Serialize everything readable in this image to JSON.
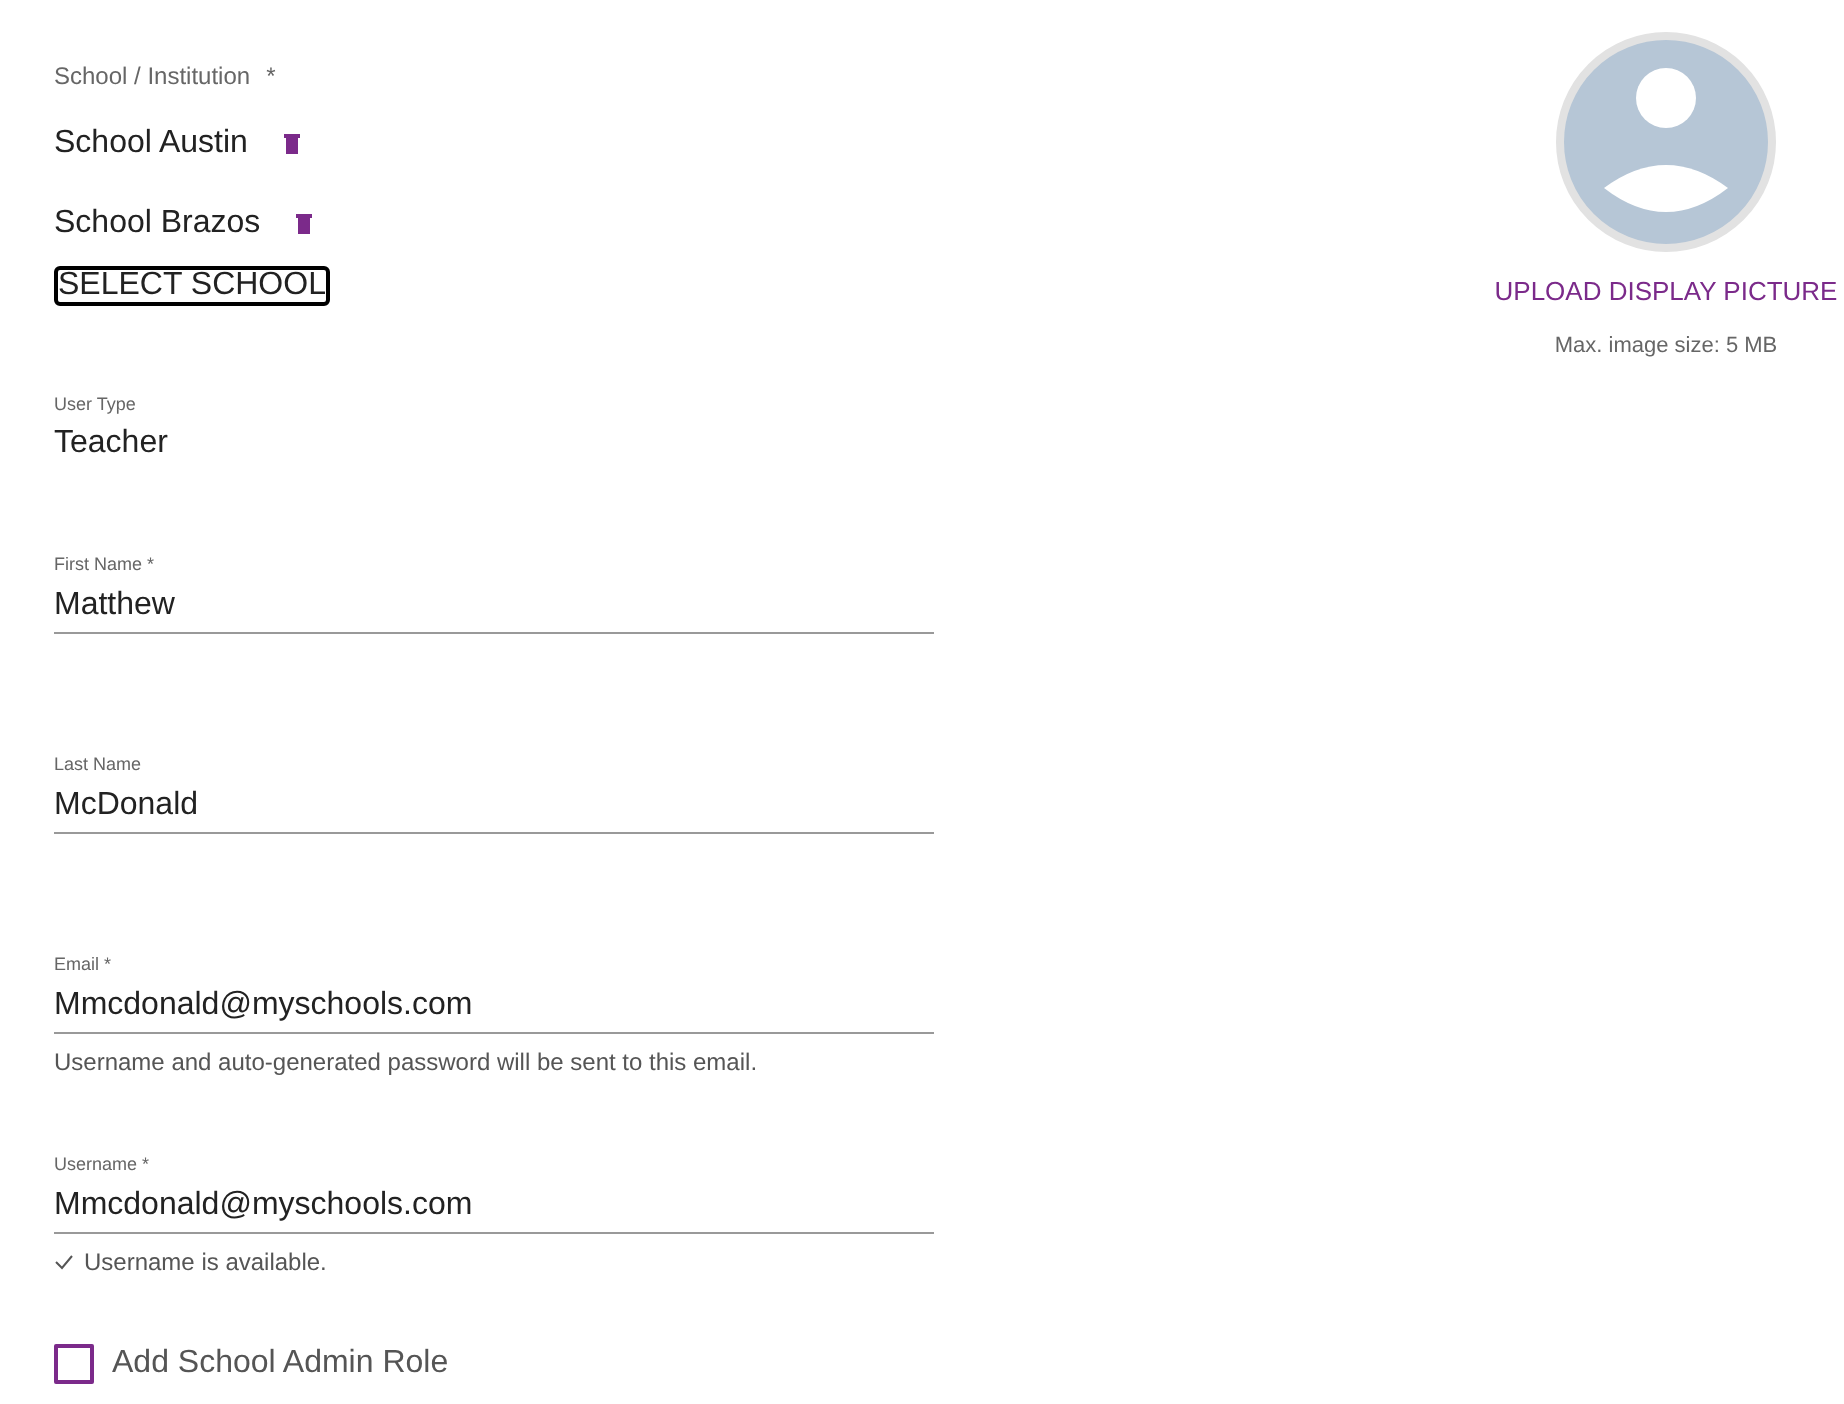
{
  "school_field": {
    "label": "School / Institution",
    "required_mark": "*",
    "schools": [
      {
        "name": "School Austin"
      },
      {
        "name": "School Brazos"
      }
    ],
    "select_button": "SELECT SCHOOL"
  },
  "user_type": {
    "label": "User Type",
    "value": "Teacher"
  },
  "fields": [
    {
      "label": "First Name *",
      "value": "Matthew"
    },
    {
      "label": "Last Name",
      "value": "McDonald"
    },
    {
      "label": "Email *",
      "value": "Mmcdonald@myschools.com",
      "hint": {
        "kind": "info",
        "text": "Username and auto-generated password will be sent to this email."
      }
    },
    {
      "label": "Username *",
      "value": "Mmcdonald@myschools.com",
      "hint": {
        "kind": "success",
        "text": "Username is available."
      }
    }
  ],
  "admin_role": {
    "label": "Add School Admin Role",
    "checked": false
  },
  "avatar": {
    "upload_button": "UPLOAD DISPLAY PICTURE",
    "size_note": "Max. image size: 5 MB"
  }
}
